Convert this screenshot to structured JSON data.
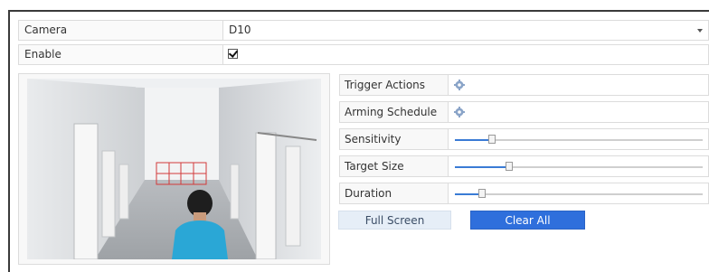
{
  "camera": {
    "label": "Camera",
    "value": "D10"
  },
  "enable": {
    "label": "Enable",
    "checked": true
  },
  "settings": {
    "trigger_actions": {
      "label": "Trigger Actions",
      "icon": "gear-icon"
    },
    "arming_schedule": {
      "label": "Arming Schedule",
      "icon": "gear-icon"
    },
    "sensitivity": {
      "label": "Sensitivity",
      "level": 0.15
    },
    "target_size": {
      "label": "Target Size",
      "level": 0.22
    },
    "duration": {
      "label": "Duration",
      "level": 0.11
    }
  },
  "buttons": {
    "full_screen": "Full Screen",
    "clear_all": "Clear All"
  },
  "colors": {
    "accent": "#2f6fdc",
    "detection_grid": "#d23a3a",
    "shirt": "#2aa7d6"
  }
}
